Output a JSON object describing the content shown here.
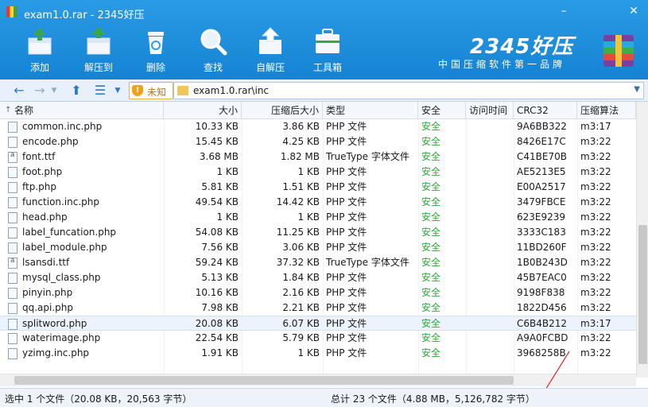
{
  "window": {
    "title": "exam1.0.rar - 2345好压",
    "minimize": "–",
    "close": "✕"
  },
  "toolbar": {
    "items": [
      {
        "label": "添加",
        "icon": "add-box-icon"
      },
      {
        "label": "解压到",
        "icon": "extract-to-icon"
      },
      {
        "label": "删除",
        "icon": "trash-icon"
      },
      {
        "label": "查找",
        "icon": "search-icon"
      },
      {
        "label": "自解压",
        "icon": "self-extract-icon"
      },
      {
        "label": "工具箱",
        "icon": "toolbox-icon"
      }
    ]
  },
  "brand": {
    "name": "2345好压",
    "slogan": "中国压缩软件第一品牌"
  },
  "nav": {
    "unsafe_label": "未知",
    "path": "exam1.0.rar\\inc"
  },
  "columns": [
    "名称",
    "大小",
    "压缩后大小",
    "类型",
    "安全",
    "访问时间",
    "CRC32",
    "压缩算法"
  ],
  "files": [
    {
      "name": "common.inc.php",
      "size": "10.33 KB",
      "packed": "3.86 KB",
      "type": "PHP 文件",
      "safe": "安全",
      "crc": "9A6BB322",
      "method": "m3:17",
      "icon": "php"
    },
    {
      "name": "encode.php",
      "size": "15.45 KB",
      "packed": "4.25 KB",
      "type": "PHP 文件",
      "safe": "安全",
      "crc": "8426E17C",
      "method": "m3:22",
      "icon": "php"
    },
    {
      "name": "font.ttf",
      "size": "3.68 MB",
      "packed": "1.82 MB",
      "type": "TrueType 字体文件",
      "safe": "安全",
      "crc": "C41BE70B",
      "method": "m3:22",
      "icon": "ttf"
    },
    {
      "name": "foot.php",
      "size": "1 KB",
      "packed": "1 KB",
      "type": "PHP 文件",
      "safe": "安全",
      "crc": "AE5213E5",
      "method": "m3:22",
      "icon": "php"
    },
    {
      "name": "ftp.php",
      "size": "5.81 KB",
      "packed": "1.51 KB",
      "type": "PHP 文件",
      "safe": "安全",
      "crc": "E00A2517",
      "method": "m3:22",
      "icon": "php"
    },
    {
      "name": "function.inc.php",
      "size": "49.54 KB",
      "packed": "14.42 KB",
      "type": "PHP 文件",
      "safe": "安全",
      "crc": "3479FBCE",
      "method": "m3:22",
      "icon": "php"
    },
    {
      "name": "head.php",
      "size": "1 KB",
      "packed": "1 KB",
      "type": "PHP 文件",
      "safe": "安全",
      "crc": "623E9239",
      "method": "m3:22",
      "icon": "php"
    },
    {
      "name": "label_funcation.php",
      "size": "54.08 KB",
      "packed": "11.25 KB",
      "type": "PHP 文件",
      "safe": "安全",
      "crc": "3333C183",
      "method": "m3:22",
      "icon": "php"
    },
    {
      "name": "label_module.php",
      "size": "7.56 KB",
      "packed": "3.06 KB",
      "type": "PHP 文件",
      "safe": "安全",
      "crc": "11BD260F",
      "method": "m3:22",
      "icon": "php"
    },
    {
      "name": "lsansdi.ttf",
      "size": "59.24 KB",
      "packed": "37.32 KB",
      "type": "TrueType 字体文件",
      "safe": "安全",
      "crc": "1B0B243D",
      "method": "m3:22",
      "icon": "ttf"
    },
    {
      "name": "mysql_class.php",
      "size": "5.13 KB",
      "packed": "1.84 KB",
      "type": "PHP 文件",
      "safe": "安全",
      "crc": "45B7EAC0",
      "method": "m3:22",
      "icon": "php"
    },
    {
      "name": "pinyin.php",
      "size": "10.16 KB",
      "packed": "2.16 KB",
      "type": "PHP 文件",
      "safe": "安全",
      "crc": "9198F838",
      "method": "m3:22",
      "icon": "php"
    },
    {
      "name": "qq.api.php",
      "size": "7.98 KB",
      "packed": "2.21 KB",
      "type": "PHP 文件",
      "safe": "安全",
      "crc": "1822D456",
      "method": "m3:22",
      "icon": "php"
    },
    {
      "name": "splitword.php",
      "size": "20.08 KB",
      "packed": "6.07 KB",
      "type": "PHP 文件",
      "safe": "安全",
      "crc": "C6B4B212",
      "method": "m3:17",
      "icon": "php",
      "selected": true
    },
    {
      "name": "waterimage.php",
      "size": "22.54 KB",
      "packed": "5.79 KB",
      "type": "PHP 文件",
      "safe": "安全",
      "crc": "A9A0FCBD",
      "method": "m3:22",
      "icon": "php"
    },
    {
      "name": "yzimg.inc.php",
      "size": "1.91 KB",
      "packed": "1 KB",
      "type": "PHP 文件",
      "safe": "安全",
      "crc": "3968258B",
      "method": "m3:22",
      "icon": "php"
    }
  ],
  "status": {
    "selected": "选中 1 个文件（20.08 KB，20,563 字节）",
    "total": "总计 23 个文件（4.88 MB，5,126,782 字节）"
  },
  "colors": {
    "toolbar": "#1e8fdc",
    "safe": "#2ea83a",
    "selected_row": "#ecf3fc",
    "annotation_arrow": "#d62b2b"
  }
}
